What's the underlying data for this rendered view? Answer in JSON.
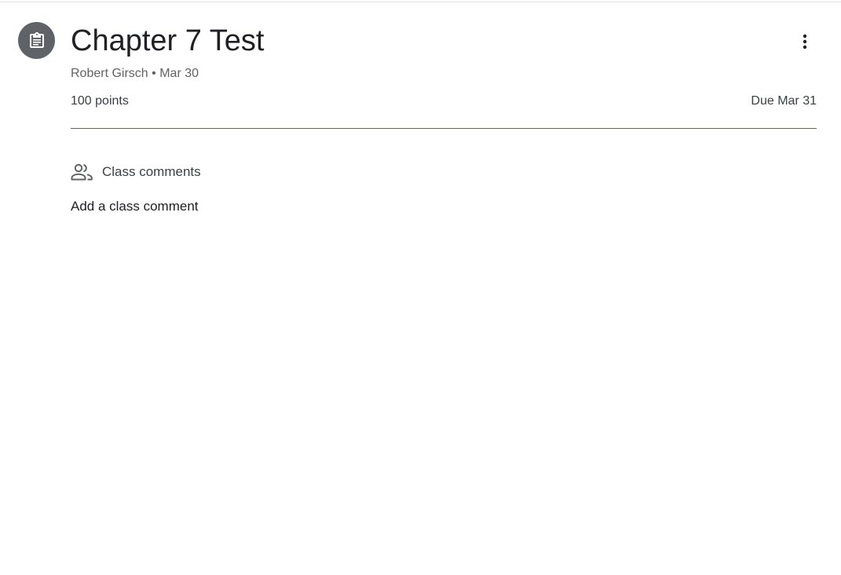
{
  "assignment": {
    "icon": "assignment-icon",
    "title": "Chapter 7 Test",
    "author": "Robert Girsch",
    "separator": "•",
    "posted_date": "Mar 30",
    "points": "100 points",
    "due": "Due Mar 31"
  },
  "menu": {
    "icon": "more-vert-icon"
  },
  "comments": {
    "icon": "people-icon",
    "header": "Class comments",
    "add_label": "Add a class comment"
  },
  "colors": {
    "icon_bg": "#5f6368",
    "title": "#202124",
    "secondary_text": "#5f6368",
    "divider": "#5f6368"
  }
}
